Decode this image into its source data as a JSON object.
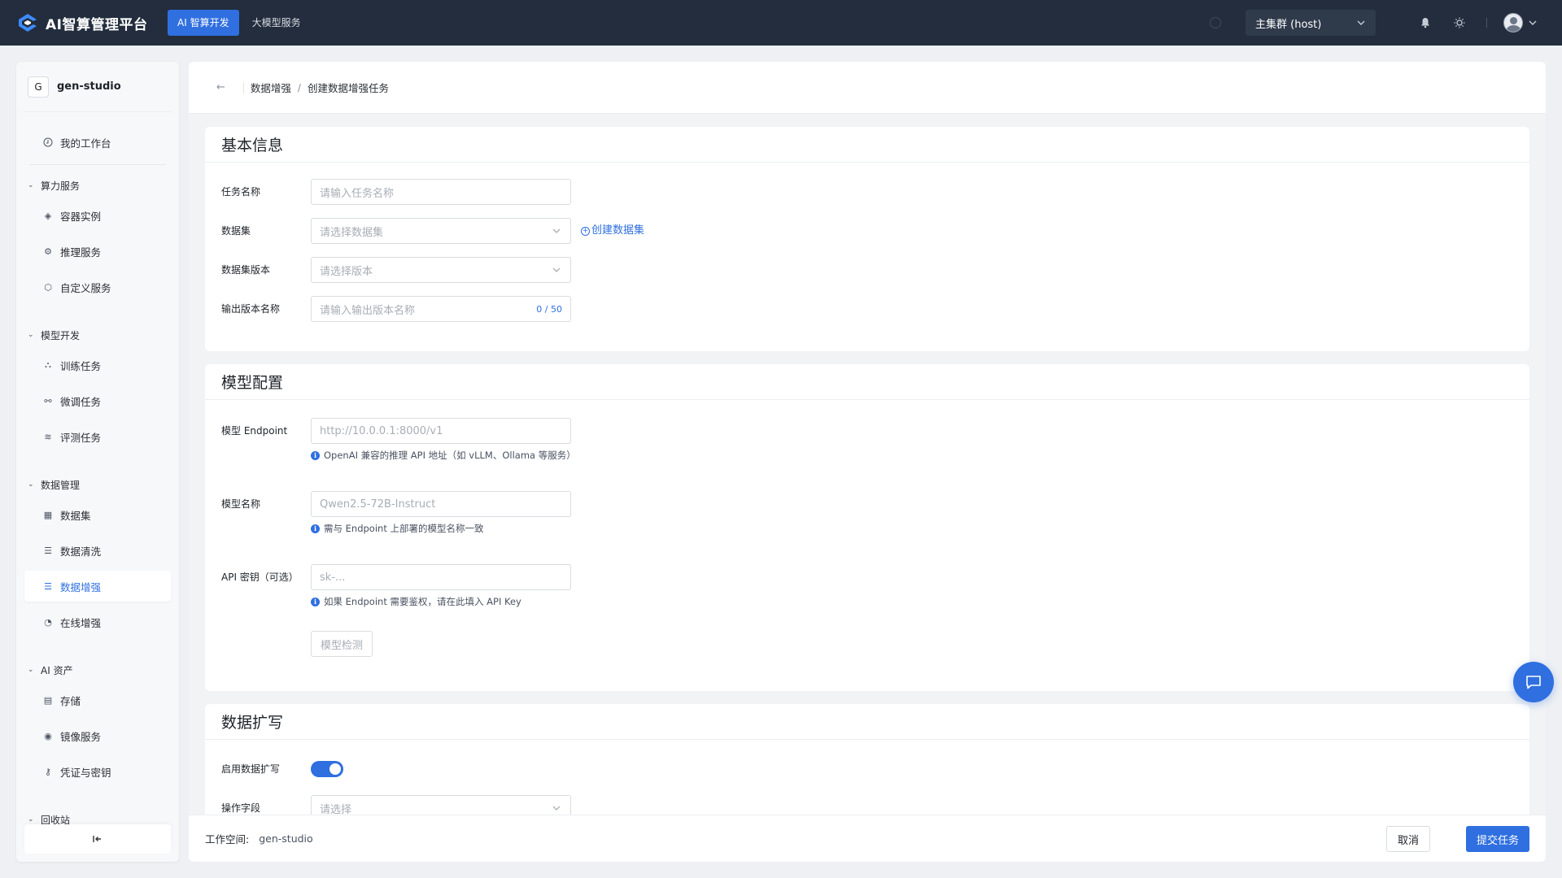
{
  "header": {
    "brand": "AI智算管理平台",
    "nav": [
      {
        "label": "AI 智算开发",
        "active": true
      },
      {
        "label": "大模型服务",
        "active": false
      }
    ],
    "cluster": "主集群 (host)"
  },
  "sidebar": {
    "workspace_badge": "G",
    "workspace_name": "gen-studio",
    "top_item": "我的工作台",
    "groups": [
      {
        "label": "算力服务",
        "items": [
          "容器实例",
          "推理服务",
          "自定义服务"
        ]
      },
      {
        "label": "模型开发",
        "items": [
          "训练任务",
          "微调任务",
          "评测任务"
        ]
      },
      {
        "label": "数据管理",
        "items": [
          "数据集",
          "数据清洗",
          "数据增强",
          "在线增强"
        ]
      },
      {
        "label": "AI 资产",
        "items": [
          "存储",
          "镜像服务",
          "凭证与密钥"
        ]
      },
      {
        "label": "回收站",
        "items": []
      }
    ],
    "active_item": "数据增强"
  },
  "breadcrumb": {
    "parent": "数据增强",
    "current": "创建数据增强任务"
  },
  "basic_info": {
    "title": "基本信息",
    "task_name_label": "任务名称",
    "task_name_placeholder": "请输入任务名称",
    "dataset_label": "数据集",
    "dataset_placeholder": "请选择数据集",
    "create_dataset_link": "创建数据集",
    "dataset_version_label": "数据集版本",
    "dataset_version_placeholder": "请选择版本",
    "output_version_label": "输出版本名称",
    "output_version_placeholder": "请输入输出版本名称",
    "output_version_counter": "0 / 50"
  },
  "model_config": {
    "title": "模型配置",
    "endpoint_label": "模型 Endpoint",
    "endpoint_placeholder": "http://10.0.0.1:8000/v1",
    "endpoint_hint": "OpenAI 兼容的推理 API 地址（如 vLLM、Ollama 等服务）",
    "model_name_label": "模型名称",
    "model_name_placeholder": "Qwen2.5-72B-Instruct",
    "model_name_hint": "需与 Endpoint 上部署的模型名称一致",
    "api_key_label": "API 密钥（可选）",
    "api_key_placeholder": "sk-...",
    "api_key_hint": "如果 Endpoint 需要鉴权，请在此填入 API Key",
    "check_button": "模型检测"
  },
  "data_expand": {
    "title": "数据扩写",
    "enable_label": "启用数据扩写",
    "enabled": true,
    "field_label": "操作字段",
    "field_placeholder": "请选择"
  },
  "footer": {
    "workspace_label": "工作空间:",
    "workspace_value": "gen-studio",
    "cancel": "取消",
    "submit": "提交任务"
  },
  "colors": {
    "primary": "#2f6fe0",
    "topbar": "#232d3d"
  }
}
